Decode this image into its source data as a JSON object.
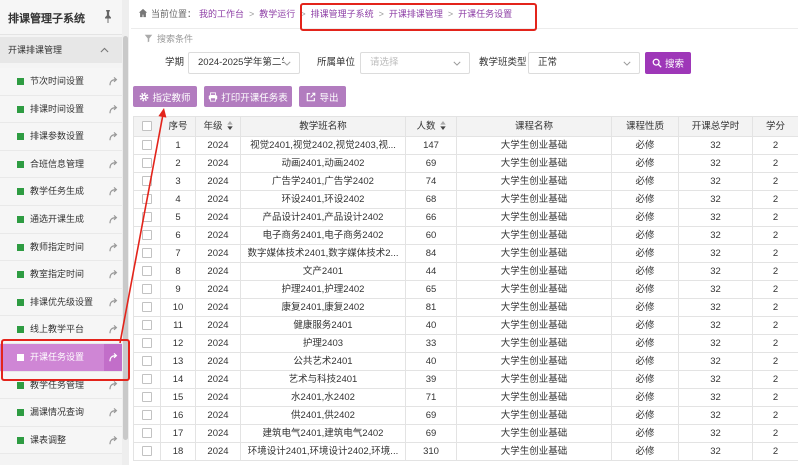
{
  "sidebar": {
    "title": "排课管理子系统",
    "section": "开课排课管理",
    "items": [
      {
        "label": "节次时间设置",
        "active": false
      },
      {
        "label": "排课时间设置",
        "active": false
      },
      {
        "label": "排课参数设置",
        "active": false
      },
      {
        "label": "合班信息管理",
        "active": false
      },
      {
        "label": "教学任务生成",
        "active": false
      },
      {
        "label": "通选开课生成",
        "active": false
      },
      {
        "label": "教师指定时间",
        "active": false
      },
      {
        "label": "教室指定时间",
        "active": false
      },
      {
        "label": "排课优先级设置",
        "active": false
      },
      {
        "label": "线上教学平台",
        "active": false
      },
      {
        "label": "开课任务设置",
        "active": true
      },
      {
        "label": "教学任务管理",
        "active": false
      },
      {
        "label": "漏课情况查询",
        "active": false
      },
      {
        "label": "课表调整",
        "active": false
      }
    ]
  },
  "breadcrumb": {
    "prefix": "当前位置：",
    "separator": ">",
    "items": [
      "我的工作台",
      "教学运行",
      "排课管理子系统",
      "开课排课管理",
      "开课任务设置"
    ]
  },
  "search": {
    "title": "搜索条件",
    "term_label": "学期",
    "term_value": "2024-2025学年第二学",
    "unit_label": "所属单位",
    "unit_placeholder": "请选择",
    "class_type_label": "教学班类型",
    "class_type_value": "正常",
    "search_label": "搜索"
  },
  "actions": {
    "assign_teacher": "指定教师",
    "print": "打印开课任务表",
    "export": "导出"
  },
  "table": {
    "columns": [
      "序号",
      "年级",
      "教学班名称",
      "人数",
      "课程名称",
      "课程性质",
      "开课总学时",
      "学分"
    ],
    "rows": [
      [
        "1",
        "2024",
        "视觉2401,视觉2402,视觉2403,视...",
        "147",
        "大学生创业基础",
        "必修",
        "32",
        "2"
      ],
      [
        "2",
        "2024",
        "动画2401,动画2402",
        "69",
        "大学生创业基础",
        "必修",
        "32",
        "2"
      ],
      [
        "3",
        "2024",
        "广告学2401,广告学2402",
        "74",
        "大学生创业基础",
        "必修",
        "32",
        "2"
      ],
      [
        "4",
        "2024",
        "环设2401,环设2402",
        "68",
        "大学生创业基础",
        "必修",
        "32",
        "2"
      ],
      [
        "5",
        "2024",
        "产品设计2401,产品设计2402",
        "66",
        "大学生创业基础",
        "必修",
        "32",
        "2"
      ],
      [
        "6",
        "2024",
        "电子商务2401,电子商务2402",
        "60",
        "大学生创业基础",
        "必修",
        "32",
        "2"
      ],
      [
        "7",
        "2024",
        "数字媒体技术2401,数字媒体技术2...",
        "84",
        "大学生创业基础",
        "必修",
        "32",
        "2"
      ],
      [
        "8",
        "2024",
        "文产2401",
        "44",
        "大学生创业基础",
        "必修",
        "32",
        "2"
      ],
      [
        "9",
        "2024",
        "护理2401,护理2402",
        "65",
        "大学生创业基础",
        "必修",
        "32",
        "2"
      ],
      [
        "10",
        "2024",
        "康复2401,康复2402",
        "81",
        "大学生创业基础",
        "必修",
        "32",
        "2"
      ],
      [
        "11",
        "2024",
        "健康服务2401",
        "40",
        "大学生创业基础",
        "必修",
        "32",
        "2"
      ],
      [
        "12",
        "2024",
        "护理2403",
        "33",
        "大学生创业基础",
        "必修",
        "32",
        "2"
      ],
      [
        "13",
        "2024",
        "公共艺术2401",
        "40",
        "大学生创业基础",
        "必修",
        "32",
        "2"
      ],
      [
        "14",
        "2024",
        "艺术与科技2401",
        "39",
        "大学生创业基础",
        "必修",
        "32",
        "2"
      ],
      [
        "15",
        "2024",
        "水2401,水2402",
        "71",
        "大学生创业基础",
        "必修",
        "32",
        "2"
      ],
      [
        "16",
        "2024",
        "供2401,供2402",
        "69",
        "大学生创业基础",
        "必修",
        "32",
        "2"
      ],
      [
        "17",
        "2024",
        "建筑电气2401,建筑电气2402",
        "69",
        "大学生创业基础",
        "必修",
        "32",
        "2"
      ],
      [
        "18",
        "2024",
        "环境设计2401,环境设计2402,环境...",
        "310",
        "大学生创业基础",
        "必修",
        "32",
        "2"
      ]
    ]
  },
  "colors": {
    "accent": "#9e37b8",
    "button": "#b27cbf",
    "active_item": "#cf86d5",
    "active_item_edge": "#c26ec9",
    "menu_icon": "#2e9c42",
    "link": "#8e3fa6",
    "annotation": "#e3241b"
  },
  "icons": {
    "sidebar_pin": "pin-icon",
    "section_toggle": "chevron-up-icon",
    "menu_item": "square-icon",
    "menu_item_open": "open-link-icon",
    "breadcrumb": "home-icon",
    "search_title": "filter-icon",
    "select": "chevron-down-icon",
    "search_button": "search-icon",
    "assign_teacher": "gear-icon",
    "print": "printer-icon",
    "export": "export-icon",
    "column_sort": "sort-icon"
  }
}
